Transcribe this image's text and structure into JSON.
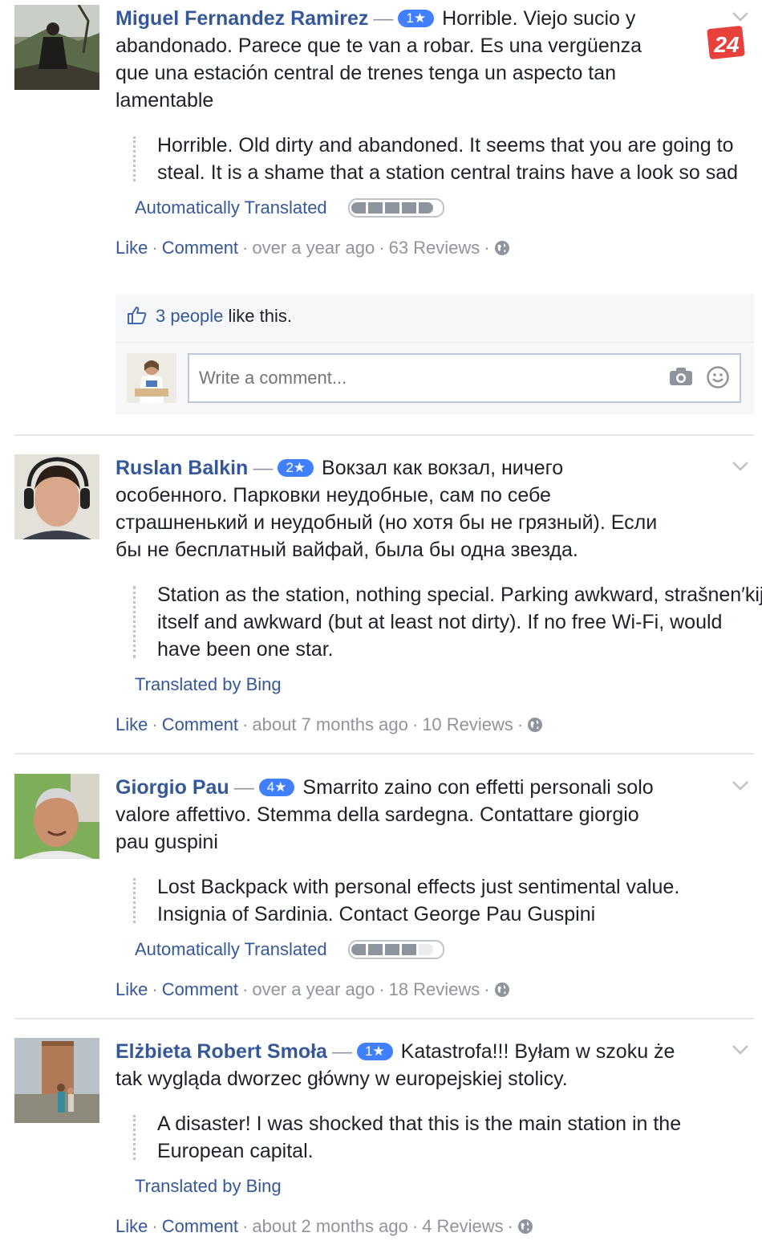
{
  "logo": {
    "text": "24"
  },
  "posts": [
    {
      "author": "Miguel Fernandez Ramirez",
      "rating": "1★",
      "text": "Horrible. Viejo sucio y abandonado. Parece que te van a robar. Es una vergüenza que una estación central de trenes tenga un aspecto tan lamentable",
      "translation": "Horrible. Old dirty and abandoned. It seems that you are going to steal. It is a shame that a station central trains have a look so sad",
      "translation_label": "Automatically Translated",
      "translation_quality": 1.0,
      "like_label": "Like",
      "comment_label": "Comment",
      "time": "over a year ago",
      "reviews": "63 Reviews"
    },
    {
      "author": "Ruslan Balkin",
      "rating": "2★",
      "text": "Вокзал как вокзал, ничего особенного. Парковки неудобные, сам по себе страшненький и неудобный (но хотя бы не грязный). Если бы не бесплатный вайфай, была бы одна звезда.",
      "translation": "Station as the station, nothing special. Parking awkward, strašnen′kij itself and awkward (but at least not dirty). If no free Wi-Fi, would have been one star.",
      "translation_label": "Translated by Bing",
      "like_label": "Like",
      "comment_label": "Comment",
      "time": "about 7 months ago",
      "reviews": "10 Reviews"
    },
    {
      "author": "Giorgio Pau",
      "rating": "4★",
      "text": "Smarrito zaino con effetti personali solo valore affettivo. Stemma della sardegna. Contattare giorgio pau guspini",
      "translation": "Lost Backpack with personal effects just sentimental value. Insignia of Sardinia. Contact George Pau Guspini",
      "translation_label": "Automatically Translated",
      "translation_quality": 0.8,
      "like_label": "Like",
      "comment_label": "Comment",
      "time": "over a year ago",
      "reviews": "18 Reviews"
    },
    {
      "author": "Elżbieta Robert Smoła",
      "rating": "1★",
      "text": "Katastrofa!!! Byłam w szoku że tak wygląda dworzec główny w europejskiej stolicy.",
      "translation": "A disaster! I was shocked that this is the main station in the European capital.",
      "translation_label": "Translated by Bing",
      "like_label": "Like",
      "comment_label": "Comment",
      "time": "about 2 months ago",
      "reviews": "4 Reviews"
    }
  ],
  "likes": {
    "count_link": "3 people",
    "suffix": " like this."
  },
  "comment_box": {
    "placeholder": "Write a comment..."
  },
  "colors": {
    "link": "#365899",
    "rating_badge": "#4080ff",
    "muted": "#90949c",
    "logo": "#e8413c"
  },
  "icons": [
    "chevron-down-icon",
    "thumbs-up-icon",
    "camera-icon",
    "smiley-icon",
    "globe-icon"
  ]
}
